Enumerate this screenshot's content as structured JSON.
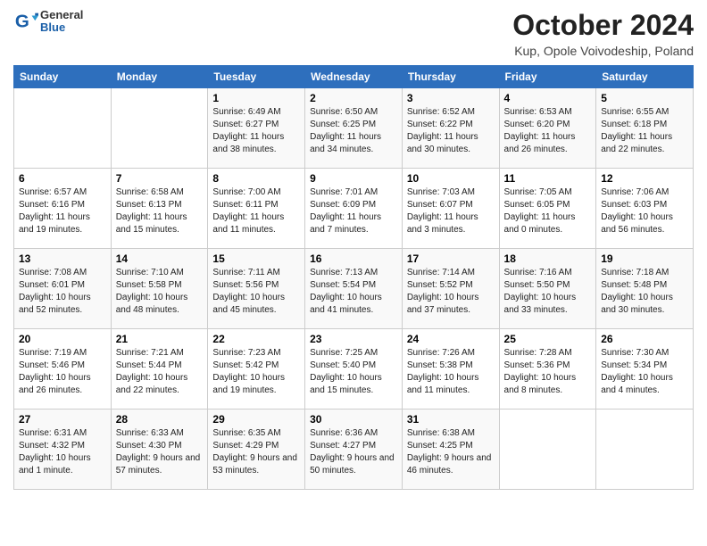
{
  "logo": {
    "general": "General",
    "blue": "Blue"
  },
  "header": {
    "title": "October 2024",
    "location": "Kup, Opole Voivodeship, Poland"
  },
  "days_of_week": [
    "Sunday",
    "Monday",
    "Tuesday",
    "Wednesday",
    "Thursday",
    "Friday",
    "Saturday"
  ],
  "weeks": [
    [
      {
        "day": "",
        "content": ""
      },
      {
        "day": "",
        "content": ""
      },
      {
        "day": "1",
        "content": "Sunrise: 6:49 AM\nSunset: 6:27 PM\nDaylight: 11 hours and 38 minutes."
      },
      {
        "day": "2",
        "content": "Sunrise: 6:50 AM\nSunset: 6:25 PM\nDaylight: 11 hours and 34 minutes."
      },
      {
        "day": "3",
        "content": "Sunrise: 6:52 AM\nSunset: 6:22 PM\nDaylight: 11 hours and 30 minutes."
      },
      {
        "day": "4",
        "content": "Sunrise: 6:53 AM\nSunset: 6:20 PM\nDaylight: 11 hours and 26 minutes."
      },
      {
        "day": "5",
        "content": "Sunrise: 6:55 AM\nSunset: 6:18 PM\nDaylight: 11 hours and 22 minutes."
      }
    ],
    [
      {
        "day": "6",
        "content": "Sunrise: 6:57 AM\nSunset: 6:16 PM\nDaylight: 11 hours and 19 minutes."
      },
      {
        "day": "7",
        "content": "Sunrise: 6:58 AM\nSunset: 6:13 PM\nDaylight: 11 hours and 15 minutes."
      },
      {
        "day": "8",
        "content": "Sunrise: 7:00 AM\nSunset: 6:11 PM\nDaylight: 11 hours and 11 minutes."
      },
      {
        "day": "9",
        "content": "Sunrise: 7:01 AM\nSunset: 6:09 PM\nDaylight: 11 hours and 7 minutes."
      },
      {
        "day": "10",
        "content": "Sunrise: 7:03 AM\nSunset: 6:07 PM\nDaylight: 11 hours and 3 minutes."
      },
      {
        "day": "11",
        "content": "Sunrise: 7:05 AM\nSunset: 6:05 PM\nDaylight: 11 hours and 0 minutes."
      },
      {
        "day": "12",
        "content": "Sunrise: 7:06 AM\nSunset: 6:03 PM\nDaylight: 10 hours and 56 minutes."
      }
    ],
    [
      {
        "day": "13",
        "content": "Sunrise: 7:08 AM\nSunset: 6:01 PM\nDaylight: 10 hours and 52 minutes."
      },
      {
        "day": "14",
        "content": "Sunrise: 7:10 AM\nSunset: 5:58 PM\nDaylight: 10 hours and 48 minutes."
      },
      {
        "day": "15",
        "content": "Sunrise: 7:11 AM\nSunset: 5:56 PM\nDaylight: 10 hours and 45 minutes."
      },
      {
        "day": "16",
        "content": "Sunrise: 7:13 AM\nSunset: 5:54 PM\nDaylight: 10 hours and 41 minutes."
      },
      {
        "day": "17",
        "content": "Sunrise: 7:14 AM\nSunset: 5:52 PM\nDaylight: 10 hours and 37 minutes."
      },
      {
        "day": "18",
        "content": "Sunrise: 7:16 AM\nSunset: 5:50 PM\nDaylight: 10 hours and 33 minutes."
      },
      {
        "day": "19",
        "content": "Sunrise: 7:18 AM\nSunset: 5:48 PM\nDaylight: 10 hours and 30 minutes."
      }
    ],
    [
      {
        "day": "20",
        "content": "Sunrise: 7:19 AM\nSunset: 5:46 PM\nDaylight: 10 hours and 26 minutes."
      },
      {
        "day": "21",
        "content": "Sunrise: 7:21 AM\nSunset: 5:44 PM\nDaylight: 10 hours and 22 minutes."
      },
      {
        "day": "22",
        "content": "Sunrise: 7:23 AM\nSunset: 5:42 PM\nDaylight: 10 hours and 19 minutes."
      },
      {
        "day": "23",
        "content": "Sunrise: 7:25 AM\nSunset: 5:40 PM\nDaylight: 10 hours and 15 minutes."
      },
      {
        "day": "24",
        "content": "Sunrise: 7:26 AM\nSunset: 5:38 PM\nDaylight: 10 hours and 11 minutes."
      },
      {
        "day": "25",
        "content": "Sunrise: 7:28 AM\nSunset: 5:36 PM\nDaylight: 10 hours and 8 minutes."
      },
      {
        "day": "26",
        "content": "Sunrise: 7:30 AM\nSunset: 5:34 PM\nDaylight: 10 hours and 4 minutes."
      }
    ],
    [
      {
        "day": "27",
        "content": "Sunrise: 6:31 AM\nSunset: 4:32 PM\nDaylight: 10 hours and 1 minute."
      },
      {
        "day": "28",
        "content": "Sunrise: 6:33 AM\nSunset: 4:30 PM\nDaylight: 9 hours and 57 minutes."
      },
      {
        "day": "29",
        "content": "Sunrise: 6:35 AM\nSunset: 4:29 PM\nDaylight: 9 hours and 53 minutes."
      },
      {
        "day": "30",
        "content": "Sunrise: 6:36 AM\nSunset: 4:27 PM\nDaylight: 9 hours and 50 minutes."
      },
      {
        "day": "31",
        "content": "Sunrise: 6:38 AM\nSunset: 4:25 PM\nDaylight: 9 hours and 46 minutes."
      },
      {
        "day": "",
        "content": ""
      },
      {
        "day": "",
        "content": ""
      }
    ]
  ]
}
